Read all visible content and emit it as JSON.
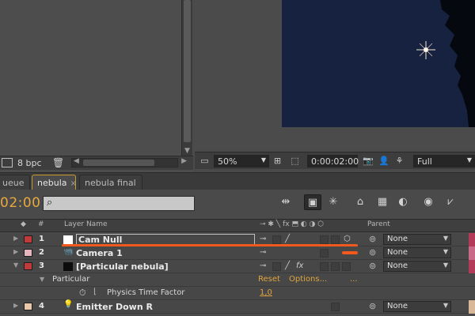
{
  "project_panel": {
    "bit_depth": "8 bpc"
  },
  "viewer": {
    "zoom": "50%",
    "timecode": "0:00:02:00",
    "resolution": "Full"
  },
  "tabs": [
    {
      "label": "ueue",
      "active": false
    },
    {
      "label": "nebula",
      "active": true
    },
    {
      "label": "nebula final",
      "active": false
    }
  ],
  "timeline": {
    "current_time": "02:00",
    "search_placeholder": "",
    "columns": {
      "layer_name": "Layer Name",
      "num": "#",
      "parent": "Parent"
    },
    "layers": [
      {
        "index": "1",
        "name": "Cam Null",
        "label_color": "#c23b3b",
        "source_color": "#ffffff",
        "parent": "None",
        "selected": true
      },
      {
        "index": "2",
        "name": "Camera 1",
        "label_color": "#e8b4c0",
        "source_color": "#202020",
        "parent": "None",
        "selected": false
      },
      {
        "index": "3",
        "name": "[Particular nebula]",
        "label_color": "#c23b3b",
        "source_color": "#0c0c0c",
        "parent": "None",
        "selected": false
      },
      {
        "index": "4",
        "name": "Emitter Down R",
        "label_color": "#e8c8a8",
        "source_color": "#f0d080",
        "parent": "None",
        "selected": false
      }
    ],
    "effect": {
      "name": "Particular",
      "reset": "Reset",
      "options": "Options...",
      "ellipsis": "..."
    },
    "property": {
      "name": "Physics Time Factor",
      "value": "1,0"
    },
    "accent": "#e8a93c",
    "marker_color": "#f25a1c"
  }
}
